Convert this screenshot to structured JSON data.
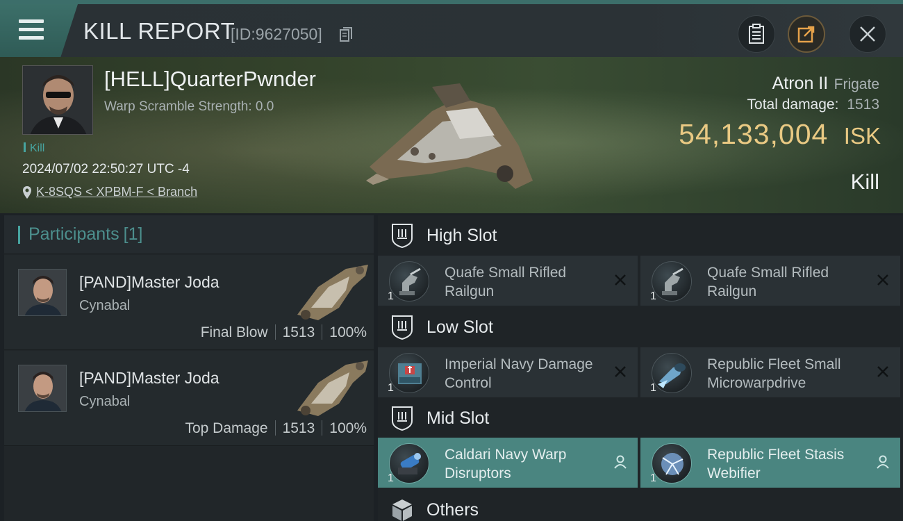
{
  "header": {
    "title": "KILL REPORT",
    "report_id": "[ID:9627050]"
  },
  "victim": {
    "name": "[HELL]QuarterPwnder",
    "warp_scramble": "Warp Scramble Strength: 0.0",
    "kill_tag": "Kill",
    "timestamp": "2024/07/02 22:50:27 UTC -4",
    "location": "K-8SQS < XPBM-F < Branch",
    "ship_name": "Atron II",
    "ship_class": "Frigate",
    "total_damage_label": "Total damage:",
    "total_damage_value": "1513",
    "isk_value": "54,133,004",
    "isk_unit": "ISK",
    "kill_type": "Kill"
  },
  "participants": {
    "title": "Participants",
    "count": "[1]",
    "items": [
      {
        "name": "[PAND]Master Joda",
        "ship": "Cynabal",
        "role": "Final Blow",
        "damage": "1513",
        "percent": "100%"
      },
      {
        "name": "[PAND]Master Joda",
        "ship": "Cynabal",
        "role": "Top Damage",
        "damage": "1513",
        "percent": "100%"
      }
    ]
  },
  "fitting": {
    "high_slot": {
      "title": "High Slot",
      "modules": [
        {
          "qty": "1",
          "name": "Quafe Small Rifled Railgun",
          "status": "destroyed"
        },
        {
          "qty": "1",
          "name": "Quafe Small Rifled Railgun",
          "status": "destroyed"
        }
      ]
    },
    "low_slot": {
      "title": "Low Slot",
      "modules": [
        {
          "qty": "1",
          "name": "Imperial Navy Damage Control",
          "status": "destroyed"
        },
        {
          "qty": "1",
          "name": "Republic Fleet Small Microwarpdrive",
          "status": "destroyed"
        }
      ]
    },
    "mid_slot": {
      "title": "Mid Slot",
      "modules": [
        {
          "qty": "1",
          "name": "Caldari Navy Warp Disruptors",
          "status": "dropped"
        },
        {
          "qty": "1",
          "name": "Republic Fleet Stasis Webifier",
          "status": "dropped"
        }
      ]
    },
    "others": {
      "title": "Others"
    }
  },
  "icons": {
    "menu": "hamburger-menu-icon",
    "copy": "copy-icon",
    "clipboard": "clipboard-icon",
    "share": "share-icon",
    "close": "close-icon",
    "location": "map-pin-icon",
    "slot": "slot-shield-icon",
    "destroyed": "close-x-icon",
    "dropped": "person-icon",
    "others": "cube-icon"
  },
  "colors": {
    "accent_teal": "#47a4a0",
    "isk_gold": "#e9c983",
    "dropped_highlight": "#4a8580"
  }
}
